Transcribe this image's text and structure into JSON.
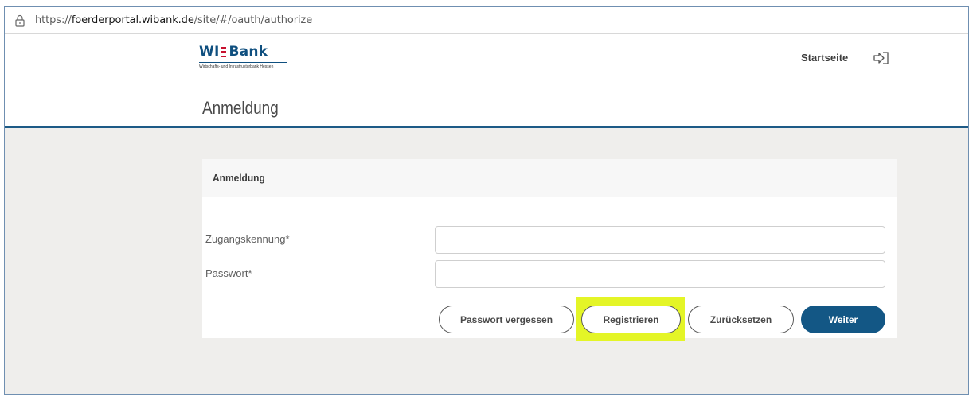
{
  "browser": {
    "url_prefix": "https://",
    "url_host": "foerderportal.wibank.de",
    "url_path": "/site/#/oauth/authorize"
  },
  "header": {
    "logo": {
      "part1": "WI",
      "part2": "Bank",
      "subtitle": "Wirtschafts- und Infrastrukturbank Hessen"
    },
    "nav_home": "Startseite",
    "login_icon": "login-arrow-icon",
    "page_title": "Anmeldung"
  },
  "card": {
    "title": "Anmeldung",
    "fields": {
      "username": {
        "label": "Zugangskennung*",
        "value": ""
      },
      "password": {
        "label": "Passwort*",
        "value": ""
      }
    },
    "buttons": {
      "forgot": "Passwort vergessen",
      "register": "Registrieren",
      "reset": "Zurücksetzen",
      "next": "Weiter"
    }
  },
  "colors": {
    "brand": "#135785",
    "highlight": "#e4f527",
    "logo_accent": "#c8102e"
  }
}
